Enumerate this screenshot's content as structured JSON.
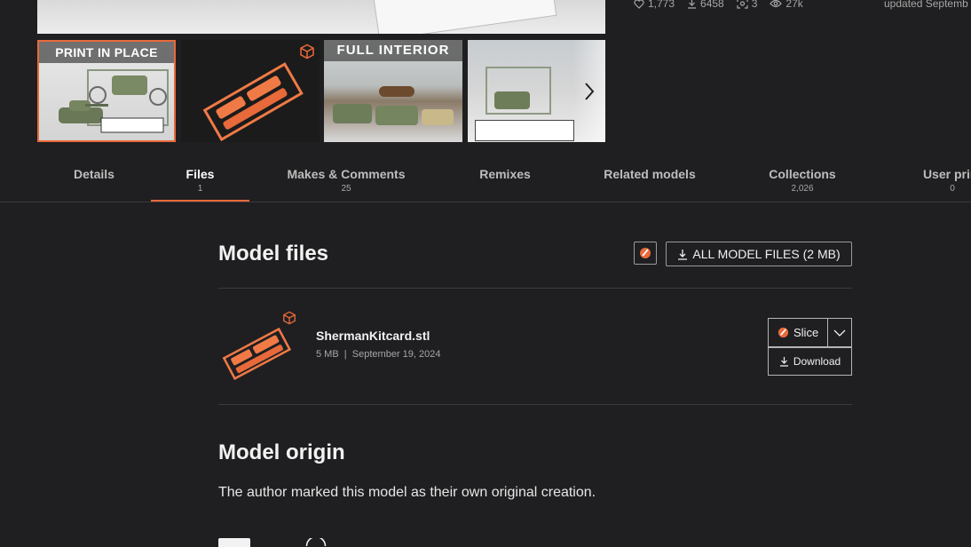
{
  "gallery": {
    "thumbnails": [
      {
        "label": "PRINT IN PLACE",
        "selected": true
      },
      {
        "label": "",
        "badge_icon": "3d-cube-icon"
      },
      {
        "label": "FULL  INTERIOR"
      },
      {
        "label": ""
      }
    ],
    "next_icon": "chevron-right-icon"
  },
  "stats": {
    "likes": "1,773",
    "downloads": "6458",
    "makes": "3",
    "views": "27k",
    "updated": "updated Septemb"
  },
  "tabs": [
    {
      "label": "Details",
      "count": ""
    },
    {
      "label": "Files",
      "count": "1",
      "active": true
    },
    {
      "label": "Makes & Comments",
      "count": "25"
    },
    {
      "label": "Remixes",
      "count": ""
    },
    {
      "label": "Related models",
      "count": ""
    },
    {
      "label": "Collections",
      "count": "2,026"
    },
    {
      "label": "User print",
      "count": "0"
    }
  ],
  "model_files": {
    "title": "Model files",
    "all_files_label": "ALL MODEL FILES (2 MB)",
    "files": [
      {
        "name": "ShermanKitcard.stl",
        "size": "5 MB",
        "date": "September 19, 2024",
        "slice_label": "Slice",
        "download_label": "Download"
      }
    ]
  },
  "model_origin": {
    "title": "Model origin",
    "text": "The author marked this model as their own original creation."
  },
  "colors": {
    "accent": "#e9693a",
    "background": "#1f1f21",
    "text": "#f2f2f2",
    "muted": "#a6a6a6"
  }
}
